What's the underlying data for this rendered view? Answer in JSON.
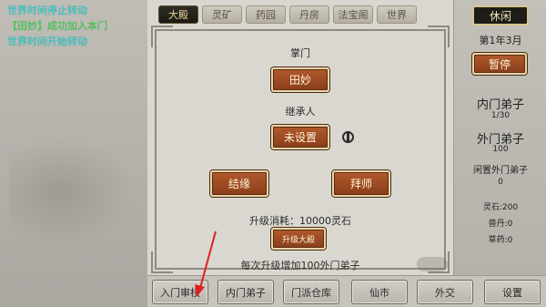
{
  "log": {
    "lines": [
      "世界时间停止转动",
      "【田妙】成功加入本门",
      "世界时间开始转动"
    ]
  },
  "tabs": [
    "大殿",
    "灵矿",
    "药园",
    "丹房",
    "法宝阁",
    "世界"
  ],
  "hall": {
    "leader_label": "掌门",
    "leader_name": "田妙",
    "heir_label": "继承人",
    "heir_value": "未设置",
    "bond_label": "结缘",
    "apprentice_label": "拜师",
    "upgrade_cost": "升级消耗：10000灵石",
    "upgrade_button": "升级大殿",
    "upgrade_note": "每次升级增加100外门弟子"
  },
  "side": {
    "mode_button": "休闲",
    "date": "第1年3月",
    "pause_button": "暂停",
    "inner_label": "内门弟子",
    "inner_value": "1/30",
    "outer_label": "外门弟子",
    "outer_value": "100",
    "idle_outer_label": "闲置外门弟子",
    "idle_outer_value": "0",
    "spirit_stone": "灵石:200",
    "beast_meat": "兽丹:0",
    "herbs": "草药:0"
  },
  "nav": [
    "入门审核",
    "内门弟子",
    "门派仓库",
    "仙市",
    "外交",
    "设置"
  ],
  "colors": {
    "log_cyan": "#1ecfd0",
    "log_green": "#35d24b",
    "button_brown": "#9a4a22",
    "annotation_red": "#e02020"
  }
}
